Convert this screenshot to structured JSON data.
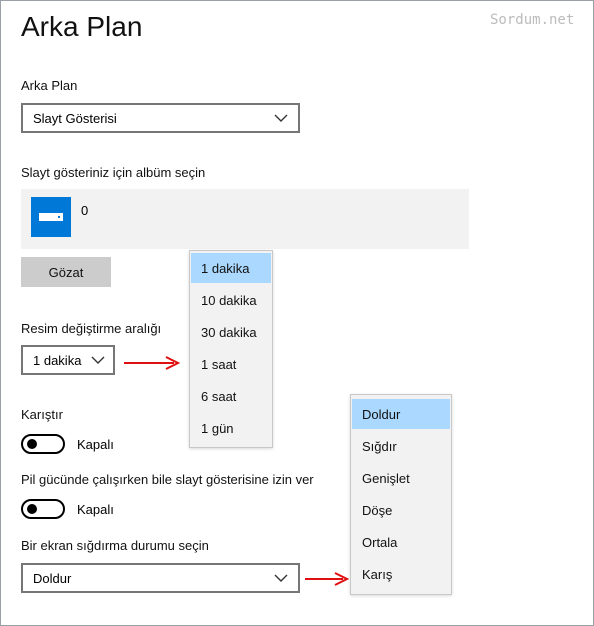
{
  "watermark": "Sordum.net",
  "title": "Arka Plan",
  "background": {
    "label": "Arka Plan",
    "value": "Slayt Gösterisi"
  },
  "album": {
    "label": "Slayt gösteriniz için albüm seçin",
    "count": "0",
    "browse_label": "Gözat"
  },
  "interval": {
    "label": "Resim değiştirme aralığı",
    "value": "1 dakika",
    "options": [
      "1 dakika",
      "10 dakika",
      "30 dakika",
      "1 saat",
      "6 saat",
      "1 gün"
    ],
    "selected": "1 dakika"
  },
  "shuffle": {
    "label": "Karıştır",
    "state": "Kapalı",
    "on": false
  },
  "battery": {
    "label": "Pil gücünde çalışırken bile slayt gösterisine izin ver",
    "state": "Kapalı",
    "on": false
  },
  "fit": {
    "label": "Bir ekran sığdırma durumu seçin",
    "value": "Doldur",
    "options": [
      "Doldur",
      "Sığdır",
      "Genişlet",
      "Döşe",
      "Ortala",
      "Karış"
    ],
    "selected": "Doldur"
  },
  "colors": {
    "accent": "#0078d7",
    "selected_option": "#aad8ff",
    "arrow": "#e01010",
    "button": "#cccccc"
  },
  "icons": {
    "chevron": "chevron-down-icon",
    "arrow": "right-arrow-icon",
    "album": "album-tile-icon"
  }
}
